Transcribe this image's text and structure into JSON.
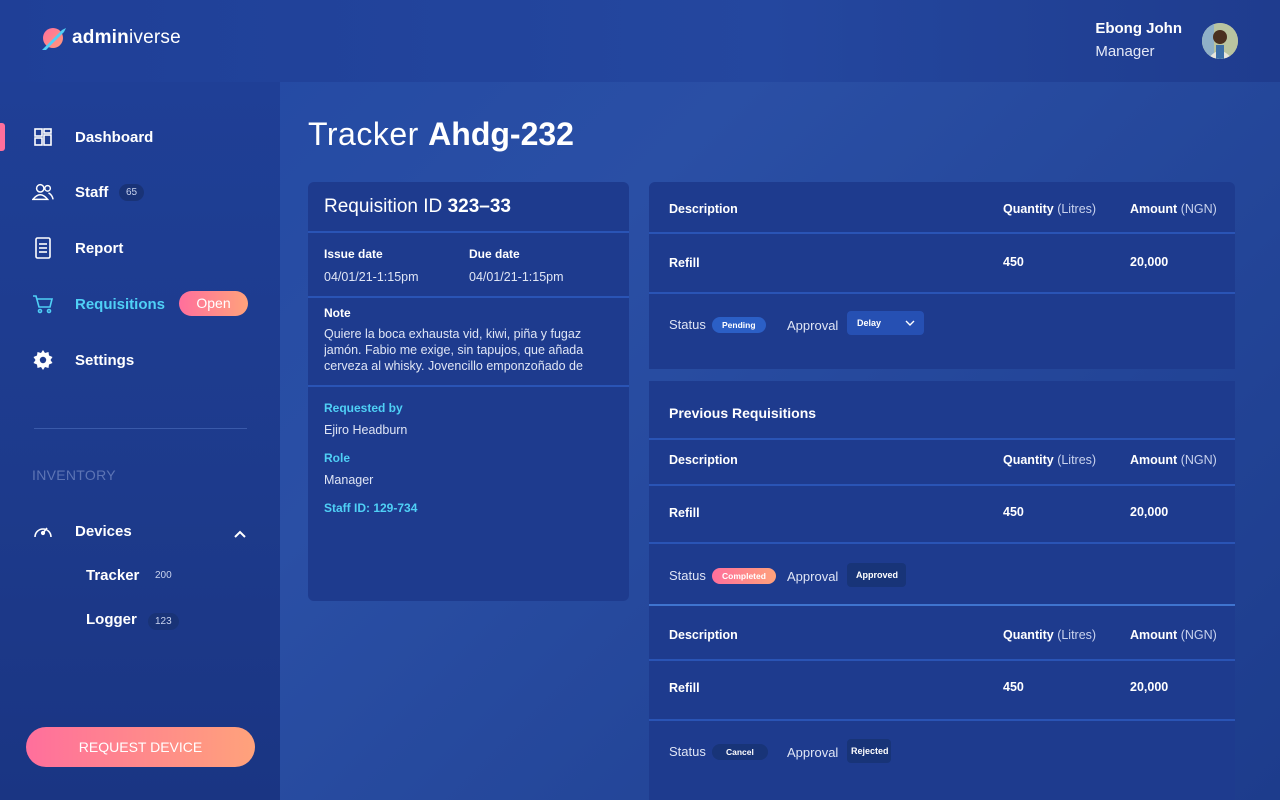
{
  "brand": {
    "bold": "admin",
    "light": "iverse"
  },
  "user": {
    "name": "Ebong John",
    "role": "Manager"
  },
  "sidebar": {
    "items": [
      {
        "label": "Dashboard",
        "icon": "dashboard-icon"
      },
      {
        "label": "Staff",
        "icon": "staff-icon",
        "count": "65"
      },
      {
        "label": "Report",
        "icon": "report-icon"
      },
      {
        "label": "Requisitions",
        "icon": "cart-icon",
        "badge": "Open",
        "active": true
      },
      {
        "label": "Settings",
        "icon": "gear-icon"
      }
    ],
    "inventory_heading": "INVENTORY",
    "devices": {
      "label": "Devices",
      "icon": "gauge-icon"
    },
    "sub_items": [
      {
        "label": "Tracker",
        "count": "200"
      },
      {
        "label": "Logger",
        "count": "123"
      }
    ],
    "request_button": "REQUEST DEVICE"
  },
  "page": {
    "title_light": "Tracker ",
    "title_bold": "Ahdg-232"
  },
  "requisition": {
    "id_label": "Requisition ID ",
    "id_value": "323–33",
    "issue_date_label": "Issue date",
    "issue_date": "04/01/21-1:15pm",
    "due_date_label": "Due date",
    "due_date": "04/01/21-1:15pm",
    "note_label": "Note",
    "note_text": "Quiere la boca exhausta vid, kiwi, piña y fugaz jamón. Fabio me exige, sin tapujos, que añada cerveza al whisky. Jovencillo emponzoñado de whisky, ¡qué",
    "requested_by_label": "Requested by",
    "requested_by": "Ejiro Headburn",
    "role_label": "Role",
    "role": "Manager",
    "staff_id": "Staff ID: 129-734"
  },
  "table_headers": {
    "description": "Description",
    "quantity": "Quantity",
    "quantity_unit": "(Litres)",
    "amount": "Amount",
    "amount_unit": "(NGN)"
  },
  "current": {
    "description": "Refill",
    "quantity": "450",
    "amount": "20,000",
    "status_label": "Status",
    "status": "Pending",
    "approval_label": "Approval",
    "approval": "Delay"
  },
  "previous_title": "Previous Requisitions",
  "previous": [
    {
      "description": "Refill",
      "quantity": "450",
      "amount": "20,000",
      "status_label": "Status",
      "status": "Completed",
      "approval_label": "Approval",
      "approval": "Approved"
    },
    {
      "description": "Refill",
      "quantity": "450",
      "amount": "20,000",
      "status_label": "Status",
      "status": "Cancel",
      "approval_label": "Approval",
      "approval": "Rejected"
    }
  ],
  "colors": {
    "accent_pink": "#ff6f9c",
    "accent_cyan": "#4fd0f6",
    "card": "#1e3b8e"
  }
}
